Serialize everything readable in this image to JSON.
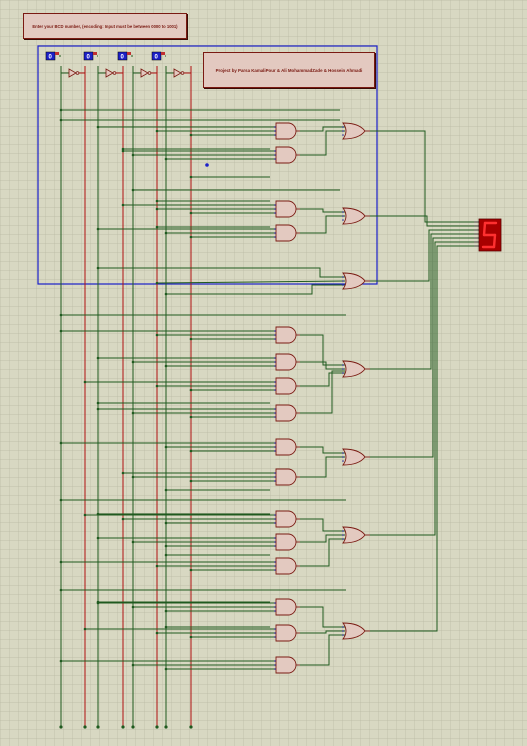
{
  "instruction": {
    "text": "Enter your BCD number, (encoding: Input must be between 0000 to 1001)"
  },
  "credits": {
    "text": "Project by Parsa KamaliPour & Ali MohammadZade & Hossein Ahmadi"
  },
  "inputs": [
    {
      "name": "input-d",
      "value": "0"
    },
    {
      "name": "input-c",
      "value": "0"
    },
    {
      "name": "input-b",
      "value": "0"
    },
    {
      "name": "input-a",
      "value": "0"
    }
  ],
  "display": {
    "digit": "5"
  },
  "colors": {
    "background": "#d8d8c0",
    "grid": "#b8b8a0",
    "wire_green": "#1f5a1f",
    "wire_red": "#b01010",
    "gate_fill": "#e3c9c0",
    "gate_stroke": "#7a1a12",
    "border_blue": "#1c20c8",
    "display_bg": "#b00000",
    "segment_on": "#ff3030"
  }
}
